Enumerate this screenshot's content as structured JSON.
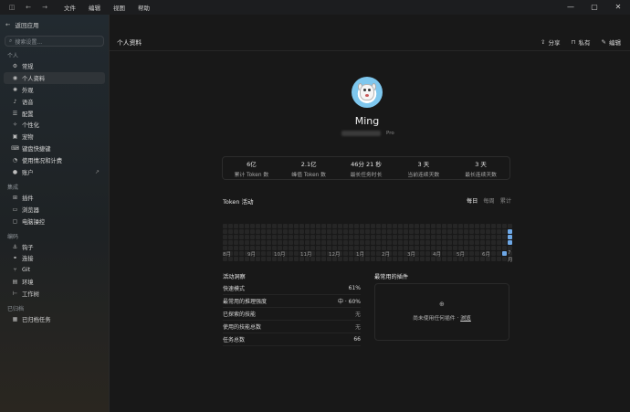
{
  "titlebar": {
    "menu": [
      "文件",
      "编辑",
      "视图",
      "帮助"
    ],
    "controls": [
      "—",
      "▢",
      "✕"
    ]
  },
  "sidebar": {
    "back_label": "返回应用",
    "search_placeholder": "搜索设置...",
    "groups": [
      {
        "title": "个人",
        "items": [
          {
            "label": "常规",
            "icon": "gear-icon"
          },
          {
            "label": "个人资料",
            "icon": "user-icon",
            "active": true
          },
          {
            "label": "外观",
            "icon": "sun-icon"
          },
          {
            "label": "语音",
            "icon": "mic-icon"
          },
          {
            "label": "配置",
            "icon": "config-icon"
          },
          {
            "label": "个性化",
            "icon": "sparkle-icon"
          },
          {
            "label": "宠物",
            "icon": "pet-icon"
          },
          {
            "label": "键盘快捷键",
            "icon": "keyboard-icon"
          },
          {
            "label": "使用情况和计费",
            "icon": "chart-icon"
          },
          {
            "label": "账户",
            "icon": "account-icon",
            "external": true
          }
        ]
      },
      {
        "title": "集成",
        "items": [
          {
            "label": "插件",
            "icon": "puzzle-icon"
          },
          {
            "label": "浏览器",
            "icon": "browser-icon"
          },
          {
            "label": "电脑操控",
            "icon": "monitor-icon"
          }
        ]
      },
      {
        "title": "编码",
        "items": [
          {
            "label": "钩子",
            "icon": "hook-icon"
          },
          {
            "label": "连接",
            "icon": "link-icon"
          },
          {
            "label": "Git",
            "icon": "git-icon"
          },
          {
            "label": "环境",
            "icon": "env-icon"
          },
          {
            "label": "工作树",
            "icon": "tree-icon"
          }
        ]
      },
      {
        "title": "已归档",
        "items": [
          {
            "label": "已归档任务",
            "icon": "archive-icon"
          }
        ]
      }
    ]
  },
  "header": {
    "title": "个人资料",
    "share_label": "分享",
    "private_label": "私有",
    "edit_label": "编辑"
  },
  "profile": {
    "name": "Ming",
    "plan": "Pro"
  },
  "stats": [
    {
      "value": "6亿",
      "label": "累计 Token 数"
    },
    {
      "value": "2.1亿",
      "label": "峰值 Token 数"
    },
    {
      "value": "46分 21 秒",
      "label": "最长任务时长"
    },
    {
      "value": "3 天",
      "label": "当前连续天数"
    },
    {
      "value": "3 天",
      "label": "最长连续天数"
    }
  ],
  "token_activity": {
    "title": "Token 活动",
    "tabs": [
      {
        "label": "每日",
        "active": true
      },
      {
        "label": "每周",
        "active": false
      },
      {
        "label": "累计",
        "active": false
      }
    ],
    "months": [
      "8月",
      "9月",
      "10月",
      "11月",
      "12月",
      "1月",
      "2月",
      "3月",
      "4月",
      "5月",
      "6月",
      "7月"
    ],
    "colors": {
      "empty": "#262626",
      "active": "#6ea8e6"
    }
  },
  "activity_stats": {
    "title": "活动洞察",
    "rows": [
      {
        "key": "快速模式",
        "value": "61%",
        "dim": false
      },
      {
        "key": "最常用的推理强度",
        "value": "中 · 60%",
        "dim": false
      },
      {
        "key": "已探索的技能",
        "value": "无",
        "dim": true
      },
      {
        "key": "使用的技能总数",
        "value": "无",
        "dim": true
      },
      {
        "key": "任务总数",
        "value": "66",
        "dim": false
      }
    ]
  },
  "plugins": {
    "title": "最常用的插件",
    "empty_text": "尚未使用任何插件 ·",
    "browse_link": "浏览"
  }
}
